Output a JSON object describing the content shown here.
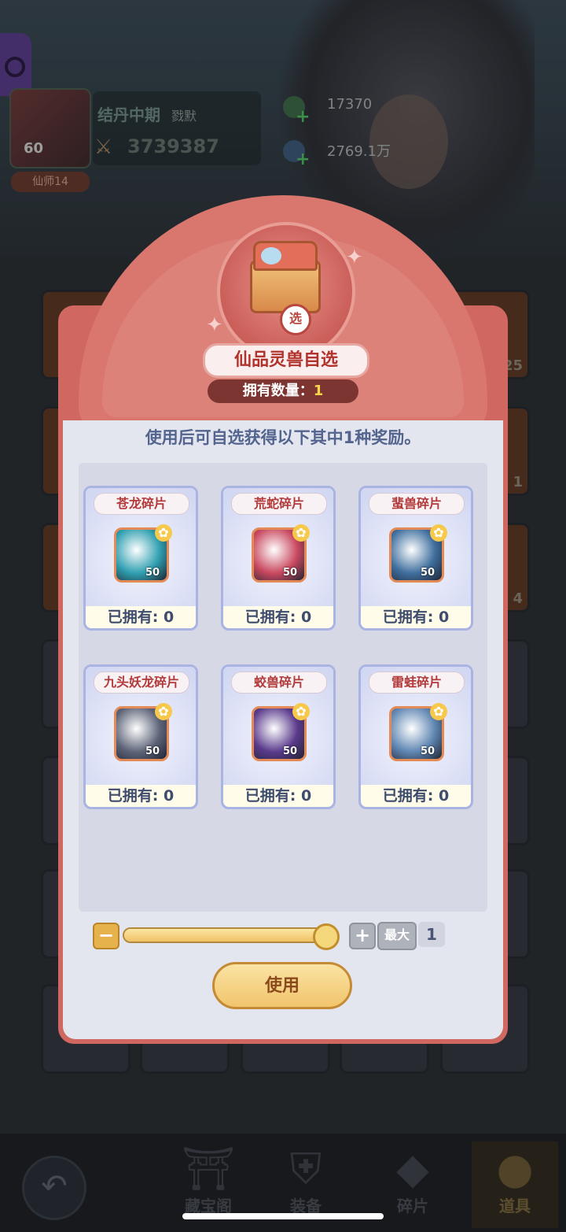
{
  "background": {
    "player": {
      "level": "60",
      "rank": "仙师14",
      "realm": "结丹中期",
      "realm_suffix": "戮默",
      "power": "3739387"
    },
    "resources": [
      {
        "icon": "green-gem-icon",
        "value": "17370"
      },
      {
        "icon": "blue-orb-icon",
        "value": "2769.1万"
      }
    ],
    "grid_counts": [
      "25",
      "1",
      "4"
    ]
  },
  "modal": {
    "title": "仙品灵兽自选",
    "count_label": "拥有数量：",
    "count_value": "1",
    "badge": "选",
    "description": "使用后可自选获得以下其中1种奖励。",
    "rewards": [
      {
        "name": "苍龙碎片",
        "level": "50",
        "owned": "已拥有: 0",
        "color": "#2f9fb0"
      },
      {
        "name": "荒蛇碎片",
        "level": "50",
        "owned": "已拥有: 0",
        "color": "#c9485f"
      },
      {
        "name": "蜚兽碎片",
        "level": "50",
        "owned": "已拥有: 0",
        "color": "#3f6f9e"
      },
      {
        "name": "九头妖龙碎片",
        "level": "50",
        "owned": "已拥有: 0",
        "color": "#5d6478"
      },
      {
        "name": "蛟兽碎片",
        "level": "50",
        "owned": "已拥有: 0",
        "color": "#5a3a8c"
      },
      {
        "name": "雷蛙碎片",
        "level": "50",
        "owned": "已拥有: 0",
        "color": "#5f86b2"
      }
    ],
    "quantity": {
      "minus": "−",
      "plus": "+",
      "max_label": "最大",
      "value": "1",
      "fill_fraction": 1.0
    },
    "use_label": "使用"
  },
  "bottom_nav": [
    {
      "label": "藏宝阁",
      "icon": "treasure-pavilion-icon"
    },
    {
      "label": "装备",
      "icon": "armor-icon"
    },
    {
      "label": "碎片",
      "icon": "fragment-icon"
    },
    {
      "label": "道具",
      "icon": "item-bag-icon",
      "active": true
    }
  ]
}
